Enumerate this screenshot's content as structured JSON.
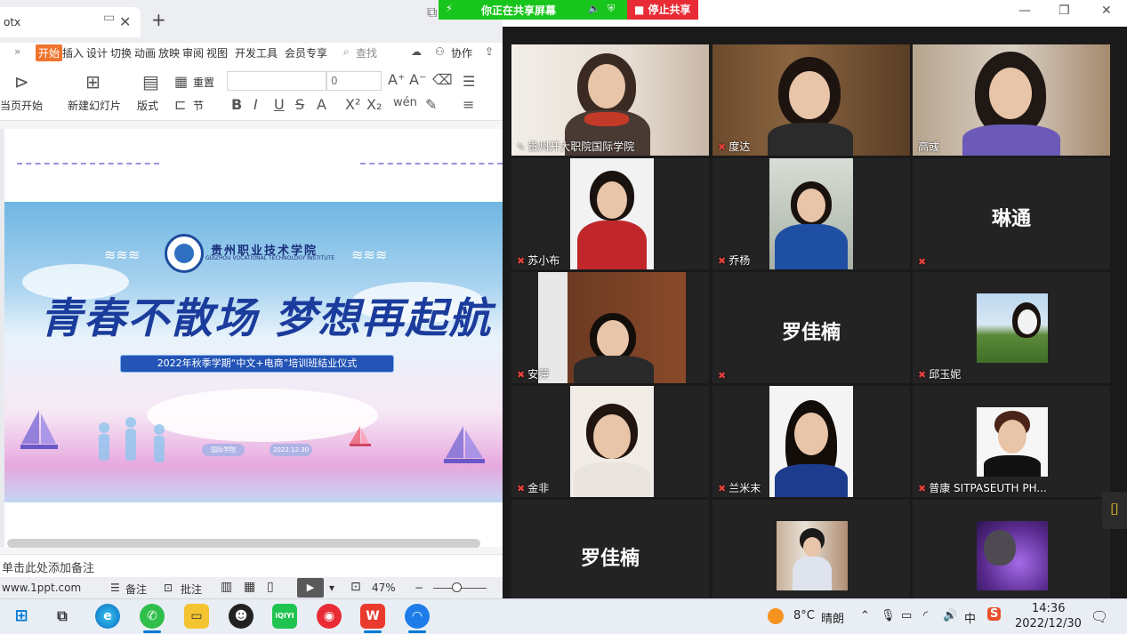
{
  "ppt": {
    "tab_title": "otx",
    "new_tab": "+",
    "menu": [
      "开始",
      "插入",
      "设计",
      "切换",
      "动画",
      "放映",
      "审阅",
      "视图",
      "开发工具",
      "会员专享"
    ],
    "search": "查找",
    "collab": "协作",
    "toolbar": {
      "from_start": "当页开始",
      "new_slide": "新建幻灯片",
      "layout": "版式",
      "reset": "重置",
      "section": "节",
      "font_size": "0"
    },
    "slide": {
      "school_cn": "贵州职业技术学院",
      "school_en": "GUIZHOU VOCATIONAL TECHNOLOGY INSTITUTE",
      "headline": "青春不散场 梦想再起航",
      "subtitle": "2022年秋季学期“中文+电商”培训班结业仪式",
      "dept": "国际学院",
      "date": "2022.12.30"
    },
    "notes": "单击此处添加备注",
    "status": {
      "site": "www.1ppt.com",
      "notes_btn": "备注",
      "comment_btn": "批注",
      "zoom": "47%"
    }
  },
  "share": {
    "label": "你正在共享屏幕",
    "stop": "停止共享"
  },
  "meeting": {
    "participants": [
      {
        "name": "贵州开大职院国际学院",
        "video": true,
        "active": true
      },
      {
        "name": "度达",
        "video": true
      },
      {
        "name": "高彧",
        "video": true
      },
      {
        "name": "苏小布",
        "video": true
      },
      {
        "name": "乔杨",
        "video": true
      },
      {
        "name": "",
        "display": "琳通",
        "video": false
      },
      {
        "name": "安萍",
        "video": true
      },
      {
        "name": "",
        "display": "罗佳楠",
        "video": false
      },
      {
        "name": "邱玉妮",
        "video": true
      },
      {
        "name": "金非",
        "video": true
      },
      {
        "name": "兰米末",
        "video": true
      },
      {
        "name": "普康 SITPASEUTH PH...",
        "video": true
      },
      {
        "name": "",
        "display": "罗佳楠",
        "video": false
      },
      {
        "name": "",
        "video": true
      },
      {
        "name": "",
        "video": true
      }
    ]
  },
  "taskbar": {
    "weather_temp": "8°C",
    "weather_text": "晴朗",
    "ime": "中",
    "time": "14:36",
    "date": "2022/12/30"
  },
  "colors": {
    "share_green": "#18c51c",
    "stop_red": "#e82b35",
    "accent_orange": "#f0742e",
    "headline_blue": "#1b3c9c"
  }
}
